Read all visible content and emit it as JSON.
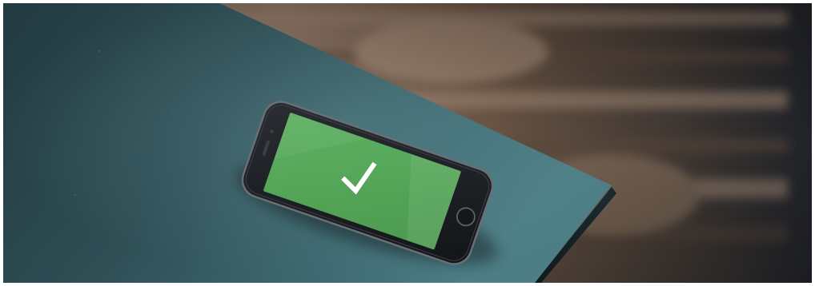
{
  "image": {
    "subject": "smartphone",
    "screen_icon": "checkmark-icon",
    "colors": {
      "desk": "#2f4e55",
      "wood": "#7a6352",
      "phone_body": "#1a1d21",
      "screen": "#57a85a",
      "check": "#ffffff"
    }
  }
}
